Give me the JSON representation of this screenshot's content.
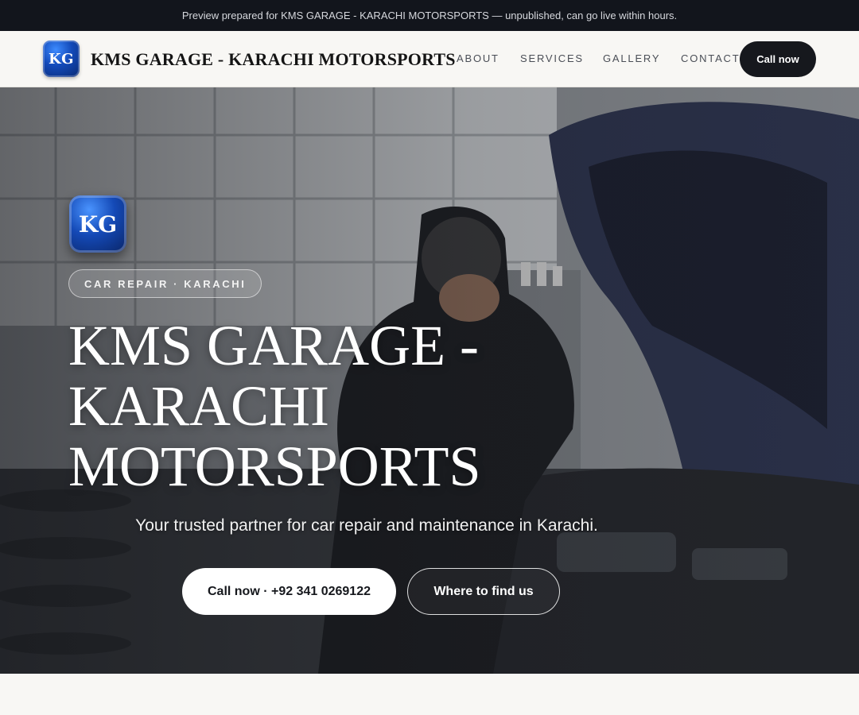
{
  "preview_bar": {
    "text": "Preview prepared for KMS GARAGE - KARACHI MOTORSPORTS — unpublished, can go live within hours."
  },
  "header": {
    "logo_initials": "KG",
    "brand_name": "KMS GARAGE - KARACHI MOTORSPORTS",
    "nav": {
      "about": "ABOUT",
      "services": "SERVICES",
      "gallery": "GALLERY",
      "contact": "CONTACT"
    },
    "cta_label": "Call now"
  },
  "hero": {
    "logo_initials": "KG",
    "eyebrow": "CAR REPAIR · KARACHI",
    "title": "KMS GARAGE - KARACHI MOTORSPORTS",
    "subtitle": "Your trusted partner for car repair and maintenance in Karachi.",
    "primary_button": "Call now · +92 341 0269122",
    "secondary_button": "Where to find us",
    "background_image": "mechanic-working-on-car-engine-photo"
  },
  "colors": {
    "preview_bar_bg": "#12151c",
    "header_bg": "#f8f7f4",
    "cta_bg": "#16181d",
    "logo_blue": "#1249b8"
  }
}
